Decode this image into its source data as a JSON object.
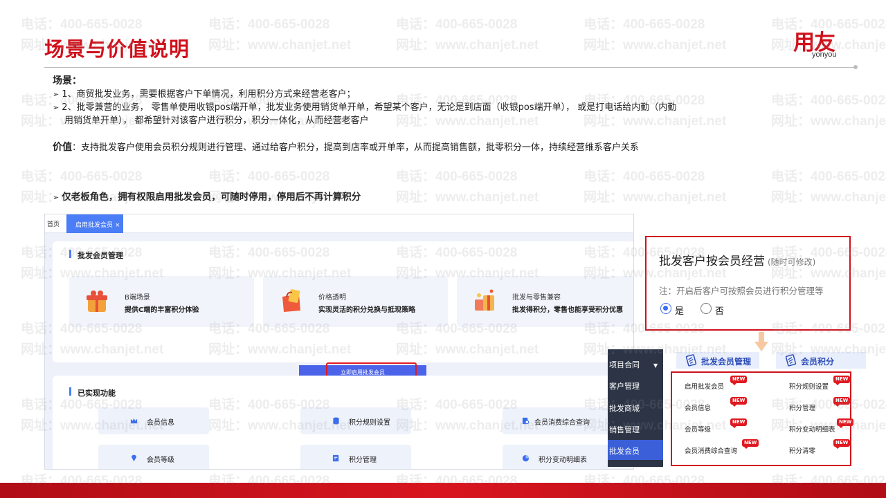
{
  "slide": {
    "title": "场景与价值说明",
    "logo": {
      "cn": "用友",
      "en": "yonyou"
    }
  },
  "watermark": {
    "phone": "电话：400-665-0028",
    "site": "网址：www.chanjet.net"
  },
  "body": {
    "scene_label": "场景：",
    "bullet1": "1、商贸批发业务，需要根据客户下单情况，利用积分方式来经营老客户；",
    "bullet2_line1": "2、批零兼营的业务， 零售单使用收银pos端开单，批发业务使用销货单开单，希望某个客户，无论是到店面（收银pos端开单）， 或是打电话给内勤（内勤",
    "bullet2_line2": "用销货单开单）， 都希望针对该客户进行积分，积分一体化，从而经营老客户",
    "value_label": "价值",
    "value_text": "：支持批发客户使用会员积分规则进行管理、通过给客户积分，提高到店率或开单率，从而提高销售额，批零积分一体，持续经营维系客户关系",
    "note": "仅老板角色，拥有权限启用批发会员，可随时停用，停用后不再计算积分"
  },
  "screenshot": {
    "tab_home": "首页",
    "tab_active": "启用批发会员",
    "tab_close": "×",
    "section1_title": "批发会员管理",
    "features": [
      {
        "title": "B端场景",
        "desc": "提供C端的丰富积分体验"
      },
      {
        "title": "价格透明",
        "desc": "实现灵活的积分兑换与抵现策略"
      },
      {
        "title": "批发与零售兼容",
        "desc": "批发得积分，零售也能享受积分优惠"
      }
    ],
    "enable_button": "立即启用批发会员",
    "section2_title": "已实现功能",
    "functions": [
      "会员信息",
      "积分规则设置",
      "会员消费综合查询",
      "会员等级",
      "积分管理",
      "积分变动明细表"
    ]
  },
  "option_box": {
    "title": "批发客户按会员经营",
    "title_sub": "(随时可修改)",
    "note": "注：开启后客户可按照会员进行积分管理等",
    "yes": "是",
    "no": "否",
    "selected": "是"
  },
  "side_menu": {
    "items": [
      "项目合同",
      "客户管理",
      "批发商城",
      "销售管理",
      "批发会员"
    ],
    "active": "批发会员"
  },
  "module_tabs": [
    "批发会员管理",
    "会员积分"
  ],
  "feature_grid": {
    "new_tag": "NEW",
    "left": [
      "启用批发会员",
      "会员信息",
      "会员等级",
      "会员消费综合查询"
    ],
    "right": [
      "积分规则设置",
      "积分管理",
      "积分变动明细表",
      "积分清零"
    ]
  },
  "colors": {
    "brand_red": "#d0101b",
    "accent_blue": "#4a7df6",
    "menu_dark": "#2c3446"
  }
}
